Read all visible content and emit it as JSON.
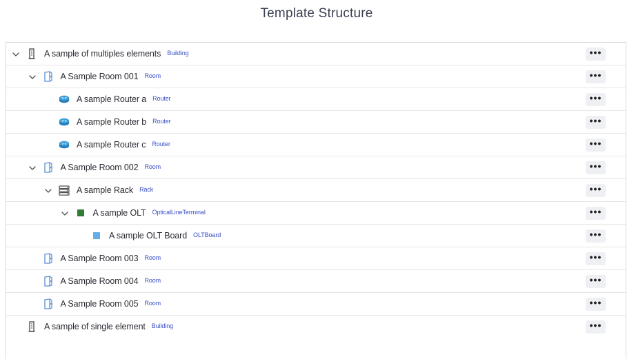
{
  "page": {
    "title": "Template Structure"
  },
  "tree": {
    "more_label": "•••",
    "rows": [
      {
        "label": "A sample of multiples elements",
        "type": "Building",
        "icon": "building-icon",
        "depth": 0,
        "expanded": true,
        "has_children": true
      },
      {
        "label": "A Sample Room 001",
        "type": "Room",
        "icon": "room-icon",
        "depth": 1,
        "expanded": true,
        "has_children": true
      },
      {
        "label": "A sample Router a",
        "type": "Router",
        "icon": "router-icon",
        "depth": 2,
        "has_children": false
      },
      {
        "label": "A sample Router b",
        "type": "Router",
        "icon": "router-icon",
        "depth": 2,
        "has_children": false
      },
      {
        "label": "A sample Router c",
        "type": "Router",
        "icon": "router-icon",
        "depth": 2,
        "has_children": false
      },
      {
        "label": "A Sample Room 002",
        "type": "Room",
        "icon": "room-icon",
        "depth": 1,
        "expanded": true,
        "has_children": true
      },
      {
        "label": "A sample Rack",
        "type": "Rack",
        "icon": "rack-icon",
        "depth": 2,
        "expanded": true,
        "has_children": true
      },
      {
        "label": "A sample OLT",
        "type": "OpticalLineTerminal",
        "icon": "olt-icon",
        "depth": 3,
        "expanded": true,
        "has_children": true
      },
      {
        "label": "A sample OLT Board",
        "type": "OLTBoard",
        "icon": "olt-board-icon",
        "depth": 4,
        "has_children": false
      },
      {
        "label": "A Sample Room 003",
        "type": "Room",
        "icon": "room-icon",
        "depth": 1,
        "has_children": false
      },
      {
        "label": "A Sample Room 004",
        "type": "Room",
        "icon": "room-icon",
        "depth": 1,
        "has_children": false
      },
      {
        "label": "A Sample Room 005",
        "type": "Room",
        "icon": "room-icon",
        "depth": 1,
        "has_children": false
      },
      {
        "label": "A sample of single element",
        "type": "Building",
        "icon": "building-icon",
        "depth": 0,
        "has_children": false
      }
    ]
  },
  "colors": {
    "type_text": "#3a4fc7",
    "olt_green": "#2e7d32",
    "board_blue": "#64aee8",
    "room_blue": "#5b8fd6",
    "router_blue": "#3d9fd8"
  }
}
